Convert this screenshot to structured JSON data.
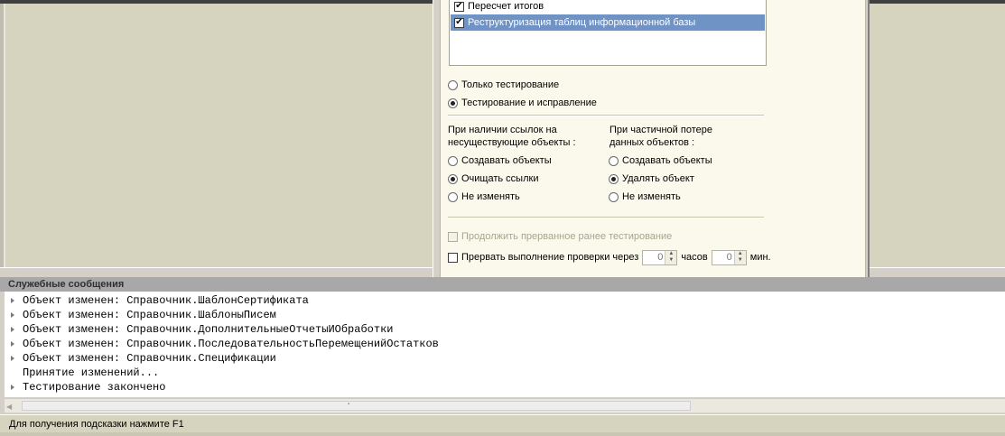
{
  "dialog": {
    "checks": [
      {
        "label": "Пересчет итогов",
        "checked": true
      },
      {
        "label": "Реструктуризация таблиц информационной базы",
        "checked": true
      }
    ],
    "mode": {
      "only_test": "Только тестирование",
      "test_fix": "Тестирование и исправление",
      "selected": "test_fix"
    },
    "refs": {
      "heading_line1": "При наличии ссылок на",
      "heading_line2": "несуществующие объекты :",
      "options": [
        "Создавать объекты",
        "Очищать ссылки",
        "Не изменять"
      ],
      "selected": 1
    },
    "partial": {
      "heading_line1": "При частичной потере",
      "heading_line2": "данных объектов :",
      "options": [
        "Создавать объекты",
        "Удалять объект",
        "Не изменять"
      ],
      "selected": 1
    },
    "continue_label": "Продолжить прерванное ранее тестирование",
    "interrupt_label": "Прервать выполнение проверки через",
    "hours_value": "0",
    "hours_unit": "часов",
    "minutes_value": "0",
    "minutes_unit": "мин."
  },
  "messages": {
    "title": "Служебные сообщения",
    "rows": [
      {
        "text": "Объект изменен: Справочник.ШаблонСертификата",
        "marker": true
      },
      {
        "text": "Объект изменен: Справочник.ШаблоныПисем",
        "marker": true
      },
      {
        "text": "Объект изменен: Справочник.ДополнительныеОтчетыИОбработки",
        "marker": true
      },
      {
        "text": "Объект изменен: Справочник.ПоследовательностьПеремещенийОстатков",
        "marker": true
      },
      {
        "text": "Объект изменен: Справочник.Спецификации",
        "marker": true
      },
      {
        "text": "Принятие изменений...",
        "marker": false
      },
      {
        "text": "Тестирование закончено",
        "marker": true
      }
    ]
  },
  "status_bar": {
    "hint": "Для получения подсказки нажмите F1"
  }
}
